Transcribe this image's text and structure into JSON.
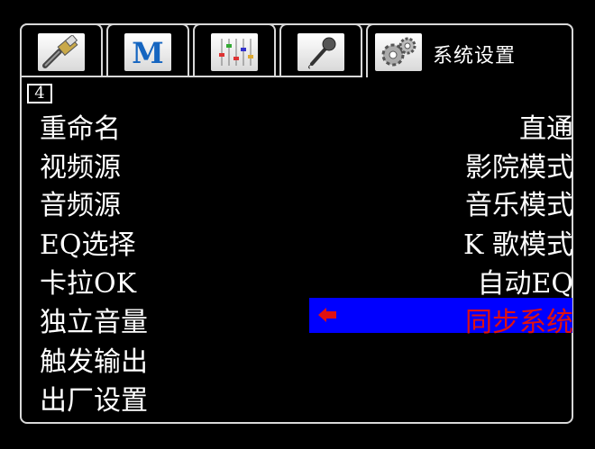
{
  "tabs": [
    {
      "name": "hdmi",
      "icon": "hdmi-cable-icon"
    },
    {
      "name": "music",
      "icon": "m-logo-icon"
    },
    {
      "name": "mixer",
      "icon": "mixer-sliders-icon"
    },
    {
      "name": "microphone",
      "icon": "microphone-icon"
    },
    {
      "name": "system",
      "icon": "gears-icon",
      "label": "系统设置"
    }
  ],
  "page_number": "4",
  "left_menu": [
    "重命名",
    "视频源",
    "音频源",
    "EQ选择",
    "卡拉OK",
    "独立音量",
    "触发输出",
    "出厂设置"
  ],
  "right_options": [
    "直通",
    "影院模式",
    "音乐模式",
    "K 歌模式",
    "自动EQ",
    "同步系统"
  ],
  "selected_option": "同步系统",
  "colors": {
    "highlight": "#0000ff",
    "selected_text": "#e01010",
    "arrow": "#e01010"
  }
}
